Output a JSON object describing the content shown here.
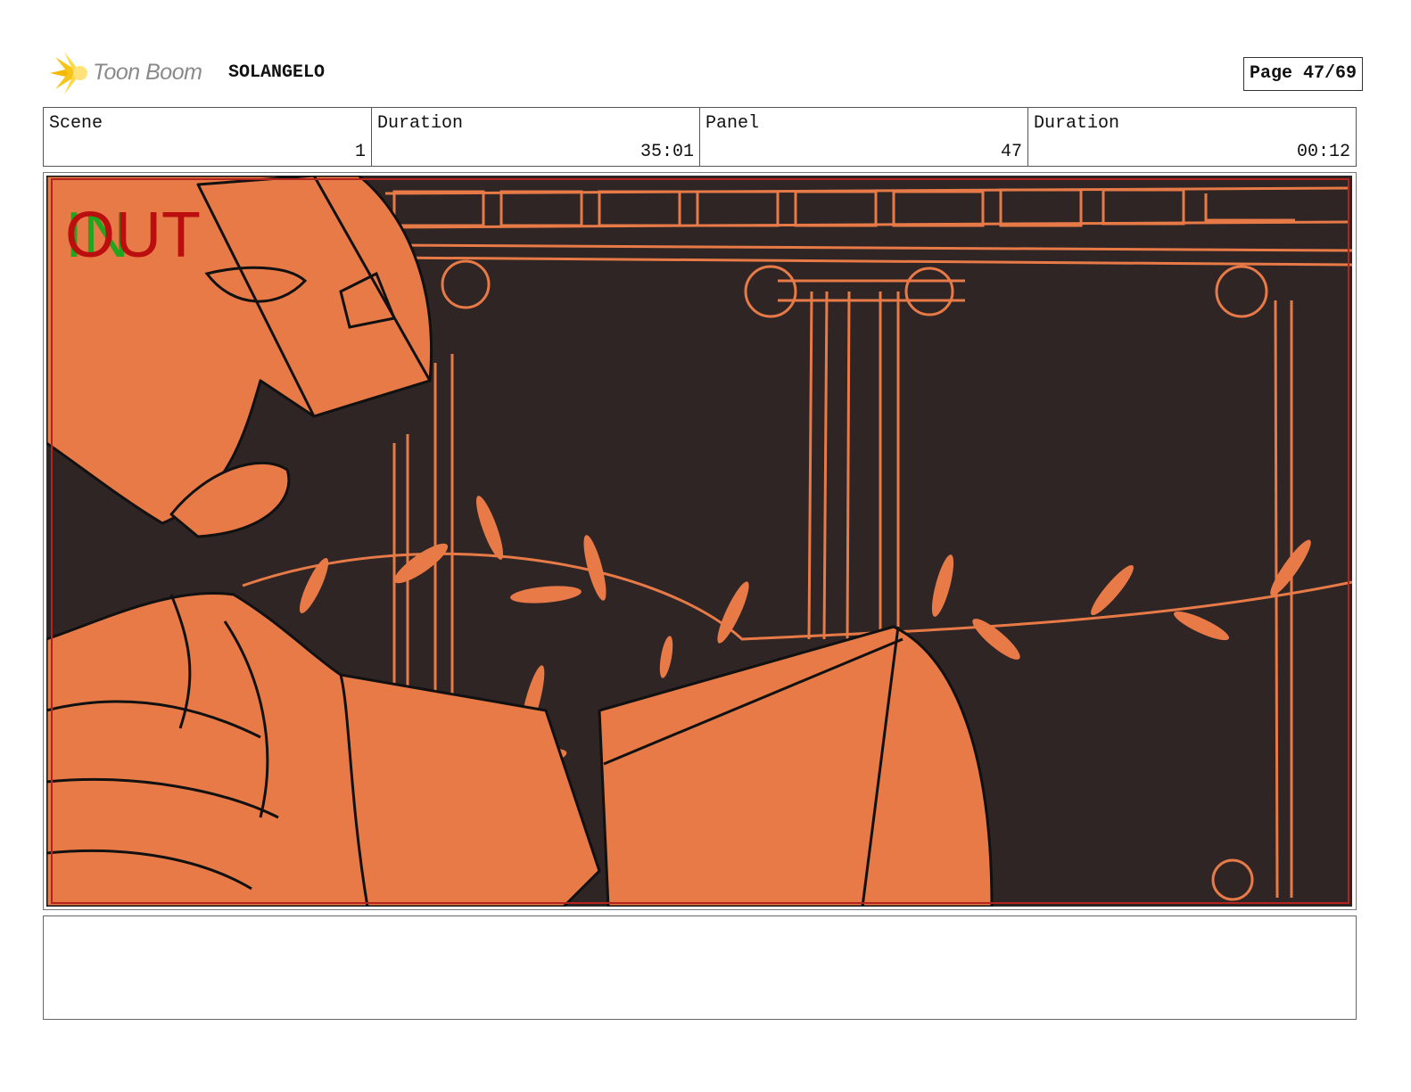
{
  "header": {
    "logo_text": "Toon Boom",
    "project_title": "SOLANGELO",
    "page_label": "Page 47/69"
  },
  "info": [
    {
      "label": "Scene",
      "value": "1"
    },
    {
      "label": "Duration",
      "value": "35:01"
    },
    {
      "label": "Panel",
      "value": "47"
    },
    {
      "label": "Duration",
      "value": "00:12"
    }
  ],
  "panel": {
    "in_marker": "IN",
    "out_marker": "OUT",
    "colors": {
      "background": "#2f2525",
      "figure": "#e87a48",
      "line": "#111111",
      "frame": "#b3241c"
    }
  },
  "notes": {
    "text": ""
  }
}
